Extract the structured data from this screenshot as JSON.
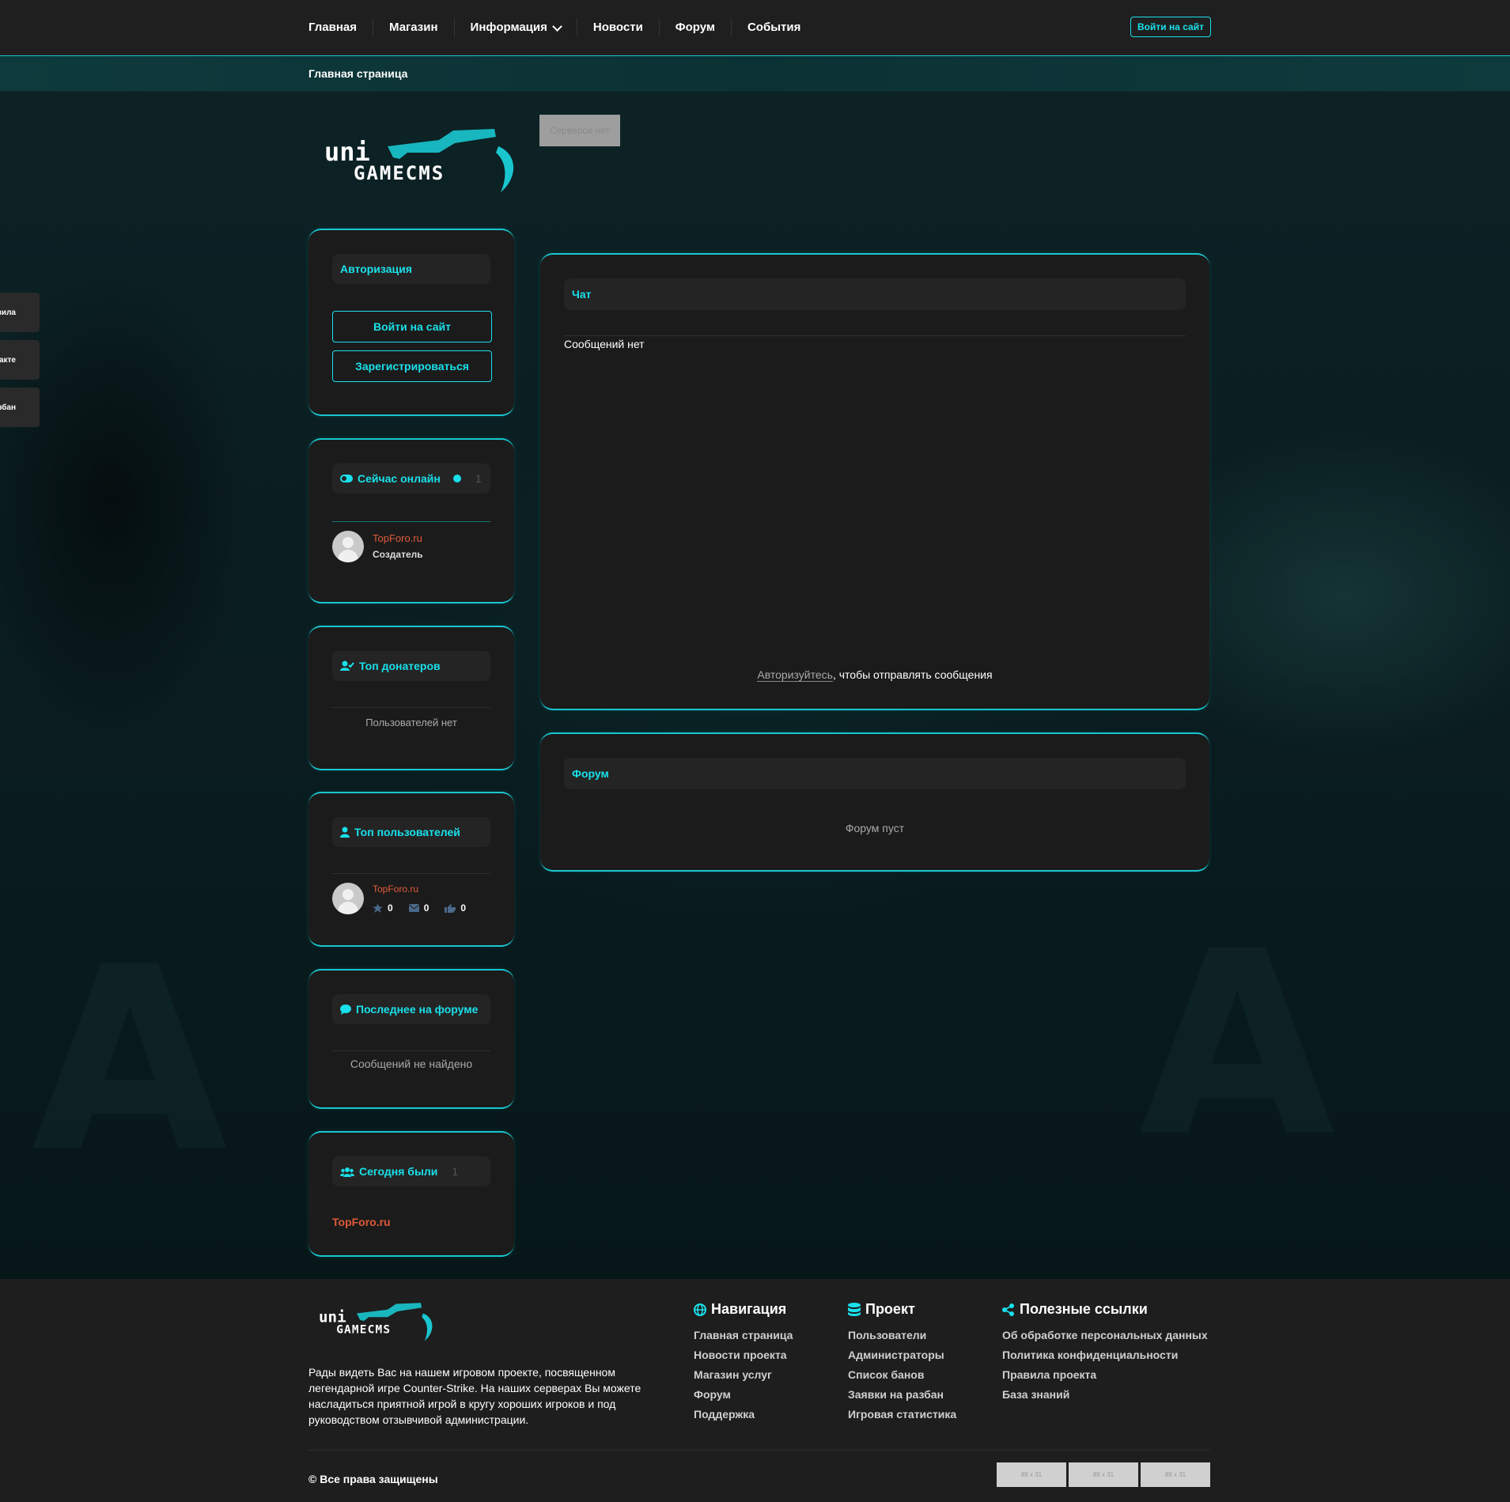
{
  "nav": {
    "items": [
      "Главная",
      "Магазин",
      "Информация",
      "Новости",
      "Форум",
      "События"
    ],
    "login_button": "Войти на сайт"
  },
  "breadcrumb": "Главная страница",
  "logo": {
    "line1": "uni",
    "line2": "GAMECMS"
  },
  "side_tabs": [
    "Правила",
    "ВКонтакте",
    "Разбан"
  ],
  "servers_badge": "Серверов нет",
  "auth_card": {
    "title": "Авторизация",
    "login_button": "Войти на сайт",
    "register_button": "Зарегистрироваться"
  },
  "online_card": {
    "title": "Сейчас онлайн",
    "count": "1",
    "user": {
      "name": "TopForo.ru",
      "role": "Создатель"
    }
  },
  "donators_card": {
    "title": "Топ донатеров",
    "empty": "Пользователей нет"
  },
  "top_users_card": {
    "title": "Топ пользователей",
    "user": {
      "name": "TopForo.ru",
      "rating": "0",
      "messages": "0",
      "likes": "0"
    }
  },
  "forum_latest_card": {
    "title": "Последнее на форуме",
    "empty": "Сообщений не найдено"
  },
  "today_card": {
    "title": "Сегодня были",
    "count": "1",
    "user": "TopForo.ru"
  },
  "chat": {
    "title": "Чат",
    "empty": "Сообщений нет",
    "auth_link": "Авторизуйтесь",
    "auth_suffix": ", чтобы отправлять сообщения"
  },
  "forum": {
    "title": "Форум",
    "empty": "Форум пуст"
  },
  "footer": {
    "about": "Рады видеть Вас на нашем игровом проекте, посвященном легендарной игре Counter-Strike. На наших серверах Вы можете насладиться приятной игрой в кругу хороших игроков и под руководством отзывчивой администрации.",
    "nav_title": "Навигация",
    "nav_links": [
      "Главная страница",
      "Новости проекта",
      "Магазин услуг",
      "Форум",
      "Поддержка"
    ],
    "project_title": "Проект",
    "project_links": [
      "Пользователи",
      "Администраторы",
      "Список банов",
      "Заявки на разбан",
      "Игровая статистика"
    ],
    "useful_title": "Полезные ссылки",
    "useful_links": [
      "Об обработке персональных данных",
      "Политика конфиденциальности",
      "Правила проекта",
      "База знаний"
    ],
    "copyright": "© Все права защищены",
    "banners": [
      "88 x 31",
      "88 x 31",
      "88 x 31"
    ]
  },
  "colors": {
    "accent": "#19e0ea",
    "username": "#e05a3a",
    "card": "#1b1b1b",
    "nav": "#1f1f1f"
  }
}
